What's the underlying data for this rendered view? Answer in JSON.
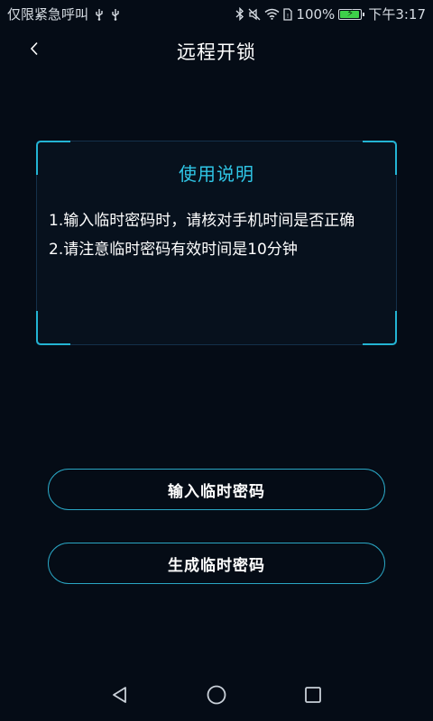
{
  "status_bar": {
    "carrier_text": "仅限紧急呼叫",
    "battery_percent": "100%",
    "battery_level": 1.0,
    "time": "下午3:17",
    "icons": [
      "usb-icon",
      "usb-icon",
      "bluetooth-icon",
      "mute-icon",
      "wifi-icon",
      "sim-icon",
      "battery-icon"
    ]
  },
  "header": {
    "title": "远程开锁",
    "back_icon": "chevron-left-icon"
  },
  "instructions": {
    "title": "使用说明",
    "lines": [
      "1.输入临时密码时，请核对手机时间是否正确",
      "2.请注意临时密码有效时间是10分钟"
    ]
  },
  "actions": {
    "enter_temp_password": "输入临时密码",
    "generate_temp_password": "生成临时密码"
  },
  "nav_bar": {
    "icons": [
      "back-triangle-icon",
      "home-circle-icon",
      "recent-square-icon"
    ]
  },
  "colors": {
    "background": "#050c16",
    "accent": "#2fc6e6",
    "button_border": "#2aa6c4",
    "battery_green": "#3ed04a"
  }
}
